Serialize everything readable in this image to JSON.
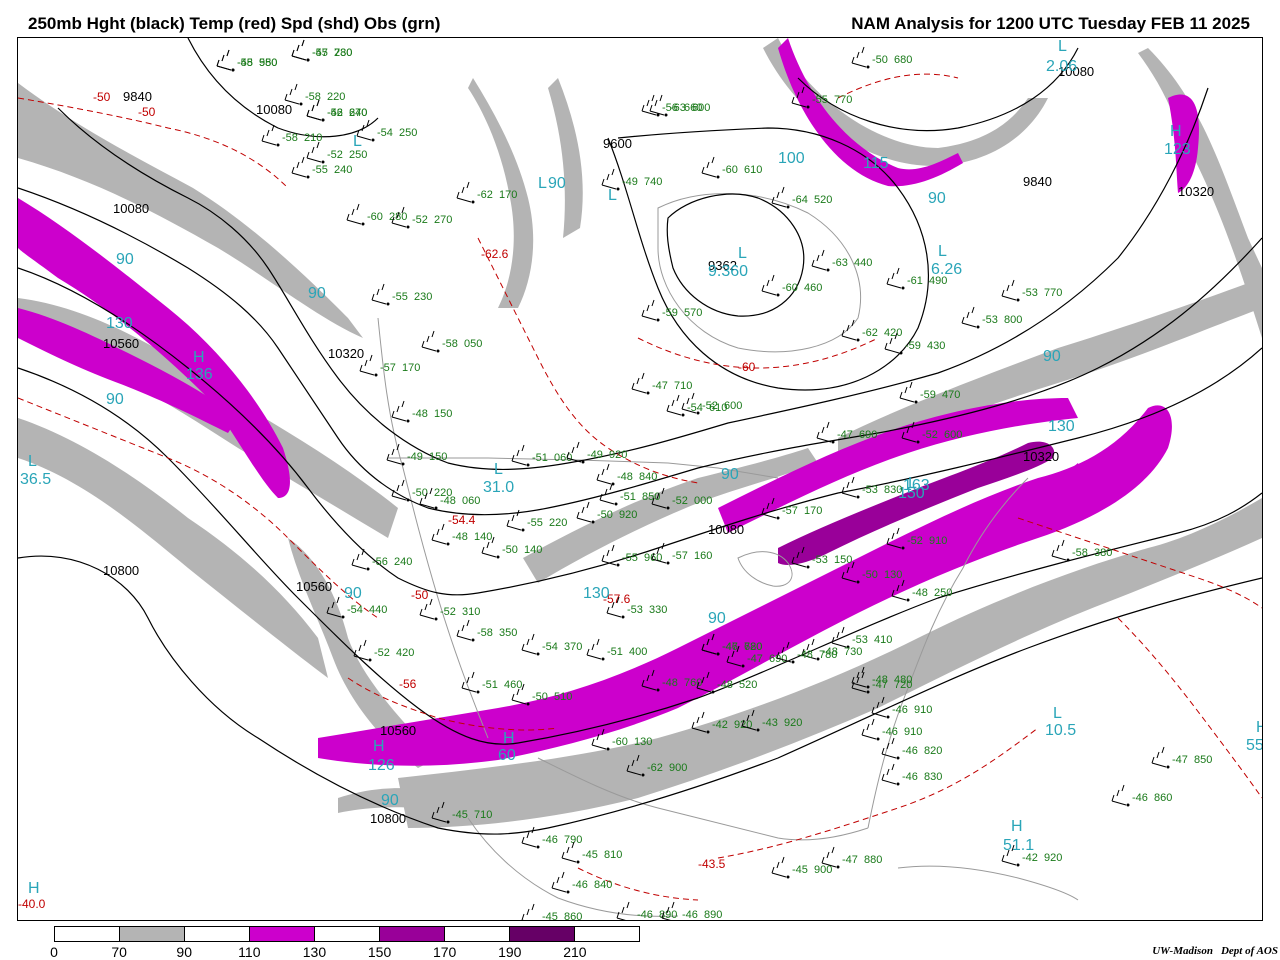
{
  "header": {
    "left_title": "250mb Hght (black) Temp (red) Spd (shd) Obs (grn)",
    "right_title": "NAM Analysis for 1200 UTC Tuesday  FEB 11 2025"
  },
  "colors": {
    "speed_70_90": "#b4b4b4",
    "speed_90_110": "#ffffff",
    "speed_110_130": "#cc00cc",
    "speed_130_150": "#ffffff",
    "speed_150_170": "#990099",
    "speed_170_190": "#ffffff",
    "speed_190_210": "#660066",
    "height_contour": "#000000",
    "temp_contour": "#c00000",
    "obs": "#1a7a1a",
    "hl_marker": "#2aa5b8",
    "geography": "#9a9a9a"
  },
  "legend": {
    "segment_colors": [
      "#ffffff",
      "#b4b4b4",
      "#ffffff",
      "#cc00cc",
      "#ffffff",
      "#990099",
      "#ffffff",
      "#660066",
      "#ffffff"
    ],
    "ticks": [
      "0",
      "70",
      "90",
      "110",
      "130",
      "150",
      "170",
      "190",
      "210"
    ]
  },
  "credit": {
    "org": "UW-Madison",
    "dept": "Dept of AOS"
  },
  "map_labels": {
    "height_labels": [
      "9840",
      "10080",
      "9600",
      "10080",
      "9840",
      "10080",
      "10320",
      "10560",
      "10320",
      "9362",
      "10800",
      "10560",
      "10560",
      "10800",
      "10320",
      "10080"
    ],
    "temp_labels": [
      "-50",
      "-50",
      "-62.6",
      "-60",
      "-50",
      "-56",
      "-54.4",
      "-57.6",
      "-43.5",
      "-40.0"
    ],
    "hl_markers": [
      "L",
      "L",
      "L",
      "L",
      "H",
      "H",
      "H",
      "H",
      "L",
      "L",
      "L",
      "L",
      "H",
      "H",
      "H",
      "L",
      "L"
    ],
    "hl_values": [
      "2.06",
      "123",
      "100",
      "115",
      "136",
      "126",
      "36.5",
      "31.0",
      "6.26",
      "163",
      "10.5",
      "51.1",
      "55",
      "60",
      "9.360"
    ],
    "speed_labels": [
      "90",
      "130",
      "90",
      "90",
      "90",
      "90",
      "90",
      "130",
      "90",
      "130",
      "90",
      "150",
      "90",
      "90"
    ],
    "obs_labels": [
      "-55 980",
      "-57 230",
      "-52 240",
      "-58 220",
      "-54 250",
      "-58 210",
      "-52 250",
      "-55 240",
      "-62 170",
      "-60 280",
      "-52 270",
      "-55 230",
      "-58 050",
      "-57 170",
      "-48 150",
      "-49 150",
      "-50 220",
      "-48 060",
      "-48 140",
      "-56 240",
      "-50 140",
      "-54 440",
      "-52 310",
      "-58 350",
      "-52 420",
      "-51 460",
      "-50 510",
      "-54 370",
      "-51 400",
      "-53 330",
      "-55 220",
      "-51 060",
      "-49 920",
      "-48 840",
      "-51 850",
      "-50 920",
      "-52 000",
      "-55 960",
      "-57 160",
      "-57 170",
      "-53 150",
      "-58 380",
      "-53 410",
      "-48 730",
      "-47 720",
      "-47 690",
      "-47 780",
      "-47 710",
      "-52 600",
      "-54 610",
      "-49 740",
      "-56 660",
      "-63 600",
      "-60 610",
      "-64 520",
      "-63 440",
      "-61 490",
      "-60 460",
      "-59 570",
      "-62 420",
      "-59 430",
      "-59 470",
      "-53 800",
      "-53 770",
      "-50 680",
      "-55 770",
      "-60 130",
      "-62 900",
      "-45 710",
      "-46 790",
      "-45 810",
      "-46 840",
      "-45 860",
      "-46 890",
      "-46 890",
      "-45 900",
      "-47 880",
      "-46 910",
      "-46 910",
      "-46 820",
      "-46 830",
      "-47 850",
      "-46 860",
      "-42 920",
      "-42 920",
      "-43 920",
      "-48 760",
      "-48 780",
      "-46 620",
      "-47 690",
      "-52 600",
      "-53 830",
      "-52 910",
      "-50 130",
      "-48 250",
      "-48 480",
      "-48 520",
      "-48 550",
      "-45 780",
      "-46 670"
    ]
  }
}
